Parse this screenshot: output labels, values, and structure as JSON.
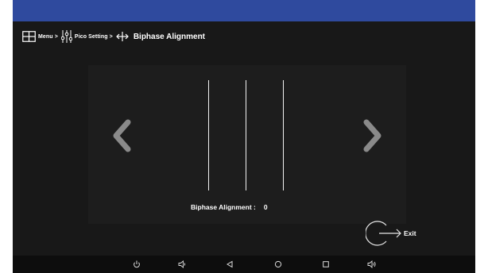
{
  "breadcrumb": {
    "menu_label": "Menu >",
    "pico_label": "Pico Setting >",
    "current_label": "Biphase Alignment",
    "icons": [
      "grid-icon",
      "sliders-icon",
      "horizontal-arrows-icon"
    ]
  },
  "main": {
    "status_label": "Biphase Alignment :",
    "status_value": "0",
    "prev_icon": "chevron-left-icon",
    "next_icon": "chevron-right-icon"
  },
  "exit": {
    "label": "Exit",
    "icon": "exit-arrow-icon"
  },
  "system_nav": [
    "power-icon",
    "volume-down-icon",
    "back-icon",
    "home-icon",
    "recents-icon",
    "volume-up-icon"
  ],
  "colors": {
    "top_bar": "#2f4a9e",
    "background": "#181818",
    "arrow": "#8a8a8a",
    "text": "#ffffff"
  }
}
